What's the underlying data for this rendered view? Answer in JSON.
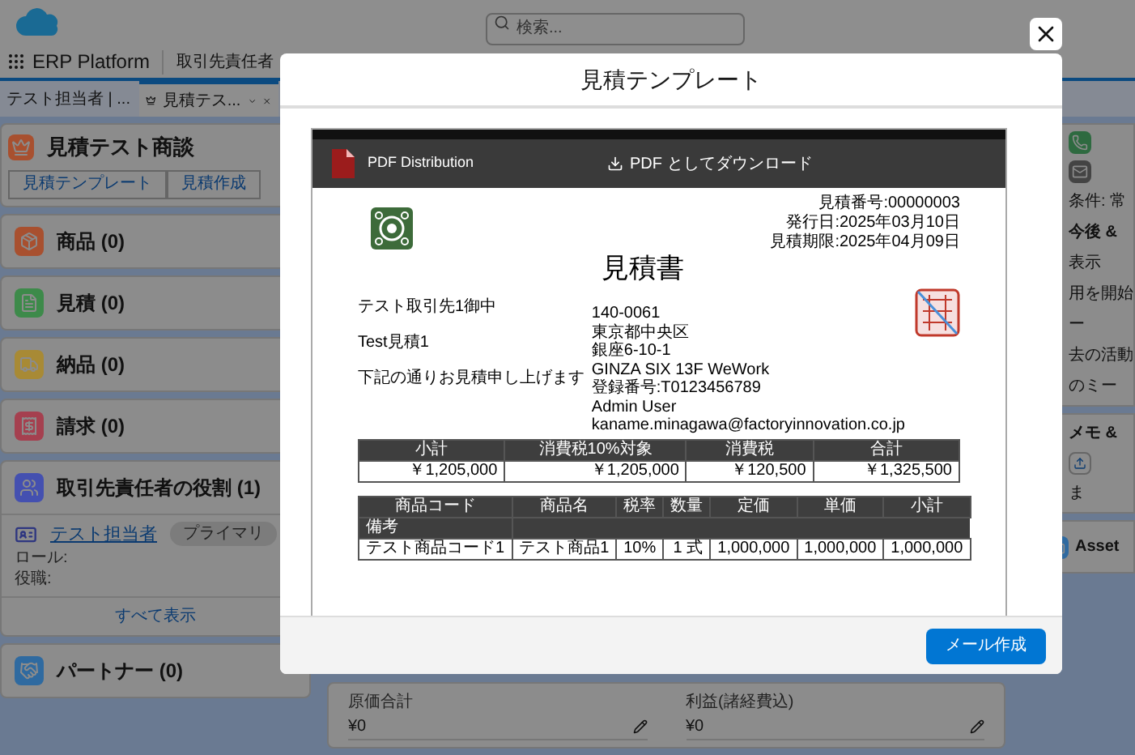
{
  "global_header": {
    "search": {
      "placeholder": "検索..."
    }
  },
  "nav": {
    "app_name": "ERP Platform",
    "tabs": [
      {
        "label": "取引先責任者"
      }
    ]
  },
  "workspace_tabs": [
    {
      "label": "テスト担当者 | ...",
      "selected": false
    },
    {
      "label": "見積テス...",
      "selected": true
    }
  ],
  "record": {
    "title": "見積テスト商談",
    "actions": [
      "見積テンプレート",
      "見積作成"
    ]
  },
  "related_lists": [
    {
      "title": "商品 (0)",
      "color": "#a8502f",
      "kind": "plain"
    },
    {
      "title": "見積 (0)",
      "color": "#3d8a4a",
      "kind": "plain"
    },
    {
      "title": "納品 (0)",
      "color": "#a88a35",
      "kind": "plain"
    },
    {
      "title": "請求 (0)",
      "color": "#a5404f",
      "kind": "plain"
    },
    {
      "title": "取引先責任者の役割 (1)",
      "color": "#4450b0",
      "kind": "contacts",
      "contact": {
        "name": "テスト担当者",
        "badge": "プライマリ",
        "fields": [
          "ロール:",
          "役職:"
        ]
      },
      "view_all": "すべて表示"
    },
    {
      "title": "パートナー (0)",
      "color": "#2f6aa0",
      "kind": "plain"
    }
  ],
  "detail_fields": [
    {
      "label": "原価合計",
      "value": "¥0"
    },
    {
      "label": "利益(諸経費込)",
      "value": "¥0"
    }
  ],
  "right_panel": {
    "filter": "条件: 常",
    "section": "今後 &",
    "texts": [
      "表示",
      "用を開始",
      "ー",
      "去の活動",
      "のミー"
    ],
    "notes_title": "メモ &",
    "notes_text": "ま",
    "asset_title": "Asset"
  },
  "modal": {
    "title": "見積テンプレート",
    "viewer": {
      "app_name": "PDF Distribution",
      "download": "PDF としてダウンロード"
    },
    "document": {
      "meta": [
        "見積番号:00000003",
        "発行日:2025年03月10日",
        "見積期限:2025年04月09日"
      ],
      "title": "見積書",
      "recipient": "テスト取引先1御中",
      "subject": "Test見積1",
      "message": "下記の通りお見積申し上げます",
      "issuer": [
        "140-0061",
        "東京都中央区",
        "銀座6-10-1",
        "GINZA SIX 13F WeWork",
        "登録番号:T0123456789",
        "Admin User",
        "kaname.minagawa@factoryinnovation.co.jp"
      ],
      "summary": {
        "columns": [
          "小計",
          "消費税10%対象",
          "消費税",
          "合計"
        ],
        "values": [
          "￥1,205,000",
          "￥1,205,000",
          "￥120,500",
          "￥1,325,500"
        ]
      },
      "items": {
        "columns": [
          "商品コード",
          "商品名",
          "税率",
          "数量",
          "定価",
          "単価",
          "小計"
        ],
        "note_label": "備考",
        "rows": [
          [
            "テスト商品コード1",
            "テスト商品1",
            "10%",
            "1 式",
            "1,000,000",
            "1,000,000",
            "1,000,000"
          ]
        ]
      }
    },
    "footer_button": "メール作成"
  }
}
